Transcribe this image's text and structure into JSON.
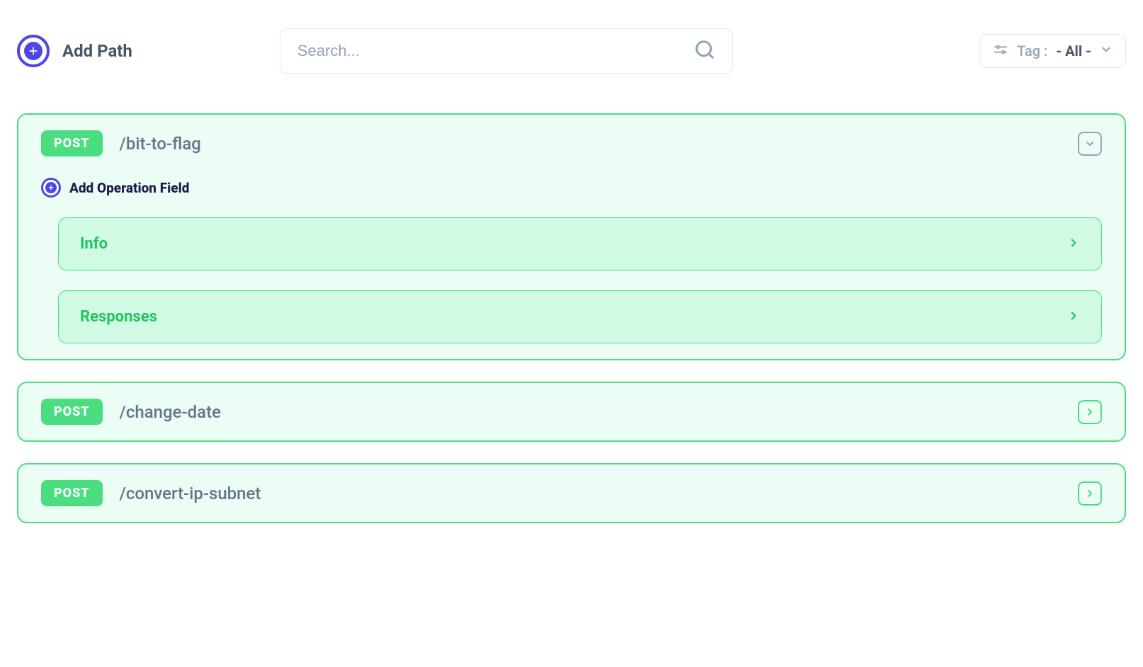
{
  "toolbar": {
    "add_path_label": "Add Path",
    "search_placeholder": "Search...",
    "tag_label": "Tag :",
    "tag_value": "- All -"
  },
  "paths": [
    {
      "method": "POST",
      "path": "/bit-to-flag",
      "expanded": true,
      "add_operation_label": "Add Operation Field",
      "sections": [
        "Info",
        "Responses"
      ]
    },
    {
      "method": "POST",
      "path": "/change-date",
      "expanded": false
    },
    {
      "method": "POST",
      "path": "/convert-ip-subnet",
      "expanded": false
    }
  ]
}
